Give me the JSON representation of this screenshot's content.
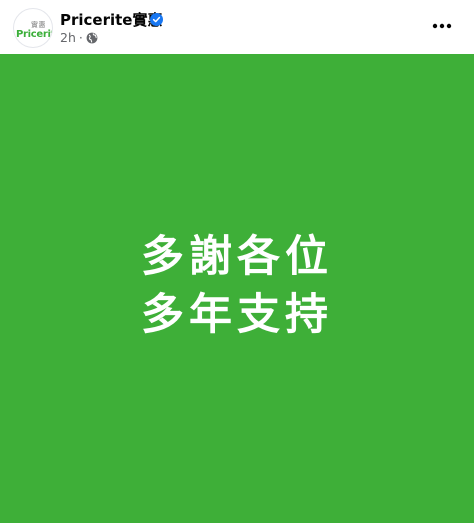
{
  "post": {
    "page_name": "Pricerite實惠",
    "verified": true,
    "time": "2h",
    "separator": "·",
    "audience_icon": "globe-icon",
    "more_icon": "more-options-icon"
  },
  "avatar": {
    "logo_text_cn": "實惠",
    "logo_text_en": "Pricerite"
  },
  "image": {
    "line1": "多謝各位",
    "line2": "多年支持",
    "background_color": "#3eaf38",
    "text_color": "#ffffff"
  },
  "colors": {
    "verified_badge": "#1877f2",
    "brand_green": "#3caf3a",
    "meta_text": "#65676b"
  }
}
